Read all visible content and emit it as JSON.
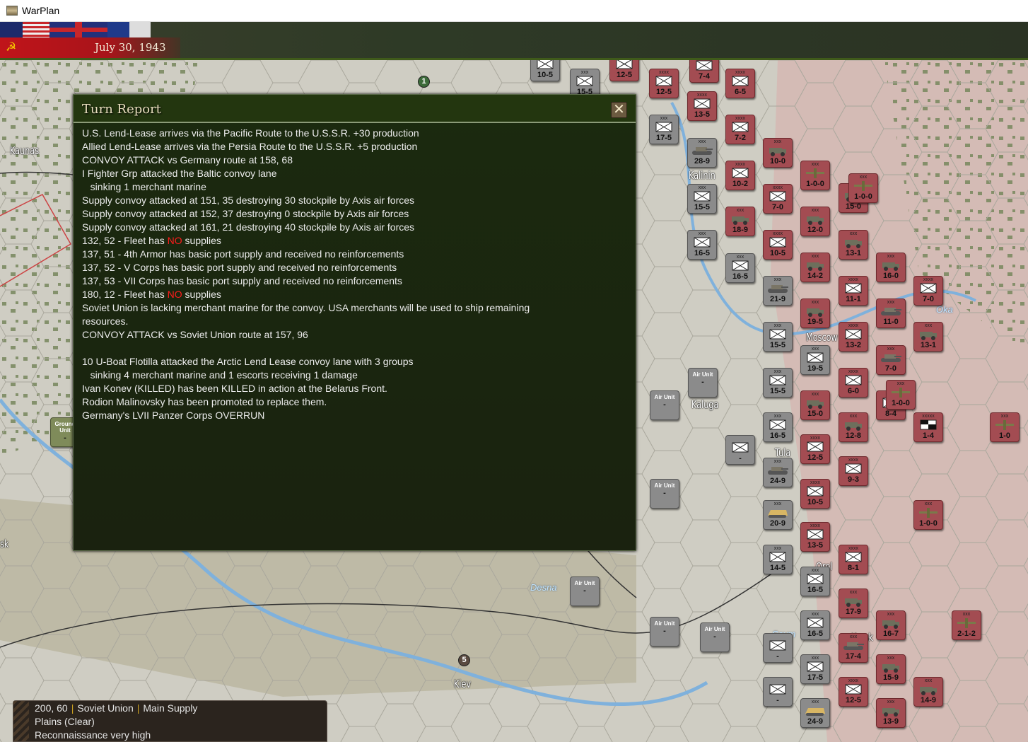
{
  "window": {
    "title": "WarPlan"
  },
  "topbar": {
    "date": "July 30, 1943",
    "side_icon": "hammer-sickle-icon"
  },
  "dialog": {
    "title": "Turn Report",
    "close_icon": "close-icon",
    "lines": [
      {
        "text": "U.S. Lend-Lease arrives via the Pacific Route to the U.S.S.R. +30 production"
      },
      {
        "text": "Allied Lend-Lease arrives via the Persia Route to the U.S.S.R. +5 production"
      },
      {
        "text": "CONVOY ATTACK vs Germany route at 158, 68"
      },
      {
        "text": "I Fighter Grp attacked the Baltic convoy lane"
      },
      {
        "text": "   sinking 1 merchant marine"
      },
      {
        "text": "Supply convoy attacked at 151, 35 destroying 30 stockpile by Axis air forces"
      },
      {
        "text": "Supply convoy attacked at 152, 37 destroying 0 stockpile by Axis air forces"
      },
      {
        "text": "Supply convoy attacked at 161, 21 destroying 40 stockpile by Axis air forces"
      },
      {
        "pre": "132, 52 - Fleet has ",
        "no": "NO",
        "post": " supplies"
      },
      {
        "text": "137, 51 - 4th Armor has basic port supply and received no reinforcements"
      },
      {
        "text": "137, 52 - V Corps has basic port supply and received no reinforcements"
      },
      {
        "text": "137, 53 - VII Corps has basic port supply and received no reinforcements"
      },
      {
        "pre": "180, 12 - Fleet has ",
        "no": "NO",
        "post": " supplies"
      },
      {
        "text": "Soviet Union is lacking merchant marine for the convoy. USA merchants will be used to ship remaining"
      },
      {
        "text": "resources."
      },
      {
        "text": "CONVOY ATTACK vs Soviet Union route at 157, 96"
      },
      {
        "text": ""
      },
      {
        "text": "10 U-Boat Flotilla attacked the Arctic Lend Lease convoy lane with 3 groups"
      },
      {
        "text": "   sinking 4 merchant marine and 1 escorts receiving 1 damage"
      },
      {
        "text": "Ivan Konev (KILLED) has been KILLED in action at the Belarus Front."
      },
      {
        "text": "Rodion Malinovsky has been promoted to replace them."
      },
      {
        "text": "Germany's LVII Panzer Corps OVERRUN"
      }
    ]
  },
  "infobox": {
    "coords": "200, 60",
    "nation": "Soviet Union",
    "supply": "Main Supply",
    "terrain": "Plains (Clear)",
    "recon": "Reconnaissance very high"
  },
  "map": {
    "cities": [
      "Kaunas",
      "Kalinin",
      "Moscow",
      "Kaluga",
      "Tula",
      "Orel",
      "Kursk",
      "Kiev",
      "sk"
    ],
    "rivers": [
      "Oka",
      "Desna",
      "Seym"
    ],
    "markers": [
      "1",
      "5"
    ],
    "colors": {
      "axis": "#8b8b8b",
      "soviet": "#a34c52",
      "ground": "#7f8b5a"
    },
    "counters": [
      {
        "side": "gray",
        "size": "",
        "type": "inf",
        "value": "10-5"
      },
      {
        "side": "gray",
        "size": "xxx",
        "type": "inf",
        "value": "15-5"
      },
      {
        "side": "red",
        "size": "",
        "type": "inf",
        "value": "12-5"
      },
      {
        "side": "red",
        "size": "xxxx",
        "type": "inf",
        "value": "12-5"
      },
      {
        "side": "red",
        "size": "",
        "type": "inf",
        "value": "7-4"
      },
      {
        "side": "red",
        "size": "xxxx",
        "type": "inf",
        "value": "6-5"
      },
      {
        "side": "red",
        "size": "xxxx",
        "type": "inf",
        "value": "13-5"
      },
      {
        "side": "gray",
        "size": "xxx",
        "type": "inf",
        "value": "17-5"
      },
      {
        "side": "red",
        "size": "xxxx",
        "type": "inf",
        "value": "7-2"
      },
      {
        "side": "gray",
        "size": "xxx",
        "type": "tank",
        "value": "28-9"
      },
      {
        "side": "red",
        "size": "xxx",
        "type": "truck",
        "value": "10-0"
      },
      {
        "side": "red",
        "size": "xxxx",
        "type": "inf",
        "value": "10-2"
      },
      {
        "side": "red",
        "size": "xxx",
        "type": "air",
        "value": "1-0-0"
      },
      {
        "side": "red",
        "size": "xxx",
        "type": "truck",
        "value": "15-0"
      },
      {
        "side": "red",
        "size": "xxx",
        "type": "air",
        "value": "1-0-0"
      },
      {
        "side": "red",
        "size": "xxxx",
        "type": "inf",
        "value": "7-0"
      },
      {
        "side": "gray",
        "size": "xxx",
        "type": "inf",
        "value": "15-5"
      },
      {
        "side": "red",
        "size": "xxx",
        "type": "truck",
        "value": "18-9"
      },
      {
        "side": "red",
        "size": "xxx",
        "type": "truck",
        "value": "12-0"
      },
      {
        "side": "gray",
        "size": "xxx",
        "type": "inf",
        "value": "16-5"
      },
      {
        "side": "red",
        "size": "xxxx",
        "type": "inf",
        "value": "10-5"
      },
      {
        "side": "red",
        "size": "xxx",
        "type": "truck",
        "value": "13-1"
      },
      {
        "side": "gray",
        "size": "xxx",
        "type": "inf",
        "value": "16-5"
      },
      {
        "side": "red",
        "size": "xxx",
        "type": "truck",
        "value": "14-2"
      },
      {
        "side": "red",
        "size": "xxx",
        "type": "truck",
        "value": "16-0"
      },
      {
        "side": "gray",
        "size": "xxx",
        "type": "tank",
        "value": "21-9"
      },
      {
        "side": "red",
        "size": "xxxx",
        "type": "inf",
        "value": "11-1"
      },
      {
        "side": "red",
        "size": "xxxx",
        "type": "inf",
        "value": "7-0"
      },
      {
        "side": "red",
        "size": "xxx",
        "type": "truck",
        "value": "19-5"
      },
      {
        "side": "red",
        "size": "xxx",
        "type": "tank",
        "value": "11-0"
      },
      {
        "side": "red",
        "size": "xxx",
        "type": "truck",
        "value": "13-1"
      },
      {
        "side": "gray",
        "size": "xxx",
        "type": "inf",
        "value": "15-5"
      },
      {
        "side": "red",
        "size": "xxxx",
        "type": "inf",
        "value": "13-2"
      },
      {
        "side": "gray",
        "size": "xxx",
        "type": "inf",
        "value": "19-5"
      },
      {
        "side": "red",
        "size": "xxx",
        "type": "tank",
        "value": "7-0"
      },
      {
        "side": "gray",
        "size": "xxx",
        "type": "inf",
        "value": "15-5"
      },
      {
        "side": "red",
        "size": "xxxx",
        "type": "inf",
        "value": "6-0"
      },
      {
        "side": "red",
        "size": "xxx",
        "type": "truck",
        "value": "15-0"
      },
      {
        "side": "red",
        "size": "xx",
        "type": "inf",
        "value": "8-4"
      },
      {
        "side": "red",
        "size": "xxx",
        "type": "air",
        "value": "1-0-0"
      },
      {
        "side": "gray",
        "size": "xxx",
        "type": "inf",
        "value": "16-5"
      },
      {
        "side": "red",
        "size": "xxx",
        "type": "truck",
        "value": "12-8"
      },
      {
        "side": "red",
        "size": "xxxxx",
        "type": "hq",
        "value": "1-4"
      },
      {
        "side": "red",
        "size": "xxx",
        "type": "air",
        "value": "1-0"
      },
      {
        "side": "gray",
        "size": "",
        "type": "inf",
        "value": "-"
      },
      {
        "side": "red",
        "size": "xxxx",
        "type": "inf",
        "value": "12-5"
      },
      {
        "side": "gray",
        "size": "xxx",
        "type": "tank",
        "value": "24-9"
      },
      {
        "side": "red",
        "size": "xxxx",
        "type": "inf",
        "value": "9-3"
      },
      {
        "side": "red",
        "size": "xxxx",
        "type": "inf",
        "value": "10-5"
      },
      {
        "side": "gray",
        "size": "xxx",
        "type": "halftrack",
        "value": "20-9"
      },
      {
        "side": "red",
        "size": "xxx",
        "type": "air",
        "value": "1-0-0"
      },
      {
        "side": "red",
        "size": "xxxx",
        "type": "inf",
        "value": "13-5"
      },
      {
        "side": "gray",
        "size": "xxx",
        "type": "inf",
        "value": "14-5"
      },
      {
        "side": "red",
        "size": "xxxx",
        "type": "inf",
        "value": "8-1"
      },
      {
        "side": "gray",
        "size": "xxx",
        "type": "inf",
        "value": "16-5"
      },
      {
        "side": "red",
        "size": "xxx",
        "type": "truck",
        "value": "17-9"
      },
      {
        "side": "red",
        "size": "xxx",
        "type": "truck",
        "value": "16-7"
      },
      {
        "side": "red",
        "size": "xxx",
        "type": "air",
        "value": "2-1-2"
      },
      {
        "side": "gray",
        "size": "xxx",
        "type": "inf",
        "value": "16-5"
      },
      {
        "side": "red",
        "size": "xxx",
        "type": "tank",
        "value": "17-4"
      },
      {
        "side": "gray",
        "size": "",
        "type": "inf",
        "value": "-"
      },
      {
        "side": "red",
        "size": "xxx",
        "type": "truck",
        "value": "15-9"
      },
      {
        "side": "gray",
        "size": "xxx",
        "type": "inf",
        "value": "17-5"
      },
      {
        "side": "red",
        "size": "xxxx",
        "type": "inf",
        "value": "12-5"
      },
      {
        "side": "red",
        "size": "xxx",
        "type": "truck",
        "value": "14-9"
      },
      {
        "side": "gray",
        "size": "",
        "type": "inf",
        "value": "-"
      },
      {
        "side": "gray",
        "size": "xxx",
        "type": "halftrack",
        "value": "24-9"
      },
      {
        "side": "red",
        "size": "xxx",
        "type": "truck",
        "value": "13-9"
      },
      {
        "side": "gray",
        "size": "",
        "type": "airunit",
        "label": "Air Unit",
        "value": "-"
      },
      {
        "side": "gray",
        "size": "",
        "type": "airunit",
        "label": "Air Unit",
        "value": "-"
      },
      {
        "side": "gray",
        "size": "",
        "type": "airunit",
        "label": "Air Unit",
        "value": "-"
      },
      {
        "side": "gray",
        "size": "",
        "type": "airunit",
        "label": "Air Unit",
        "value": "-"
      },
      {
        "side": "gray",
        "size": "",
        "type": "airunit",
        "label": "Air Unit",
        "value": "-"
      },
      {
        "side": "gray",
        "size": "",
        "type": "airunit",
        "label": "Air Unit",
        "value": "-"
      },
      {
        "side": "olive",
        "size": "",
        "type": "airunit",
        "label": "Ground Unit",
        "value": "-"
      }
    ]
  }
}
